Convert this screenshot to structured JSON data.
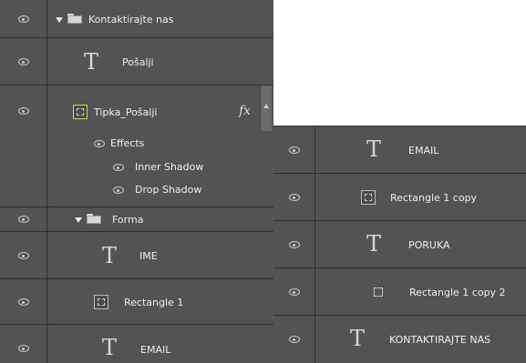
{
  "left_panel": {
    "rows": [
      {
        "label": "Kontaktirajte nas",
        "type": "group"
      },
      {
        "label": "Pošalji",
        "type": "text"
      },
      {
        "label": "Tipka_Pošalji",
        "type": "shape",
        "fx": "fx"
      },
      {
        "label": "Forma",
        "type": "group"
      },
      {
        "label": "IME",
        "type": "text"
      },
      {
        "label": "Rectangle 1",
        "type": "shape"
      },
      {
        "label": "EMAIL",
        "type": "text"
      }
    ],
    "effects": {
      "title": "Effects",
      "items": [
        "Inner Shadow",
        "Drop Shadow"
      ]
    },
    "text_glyph": "T"
  },
  "right_panel": {
    "rows": [
      {
        "label": "EMAIL",
        "type": "text"
      },
      {
        "label": "Rectangle 1 copy",
        "type": "shape"
      },
      {
        "label": "PORUKA",
        "type": "text"
      },
      {
        "label": "Rectangle 1 copy 2",
        "type": "shape"
      },
      {
        "label": "KONTAKTIRAJTE NAS",
        "type": "text"
      }
    ]
  },
  "colors": {
    "panel_bg": "#535353",
    "divider": "#2f2f2f",
    "selected_border": "#b8e24a"
  }
}
